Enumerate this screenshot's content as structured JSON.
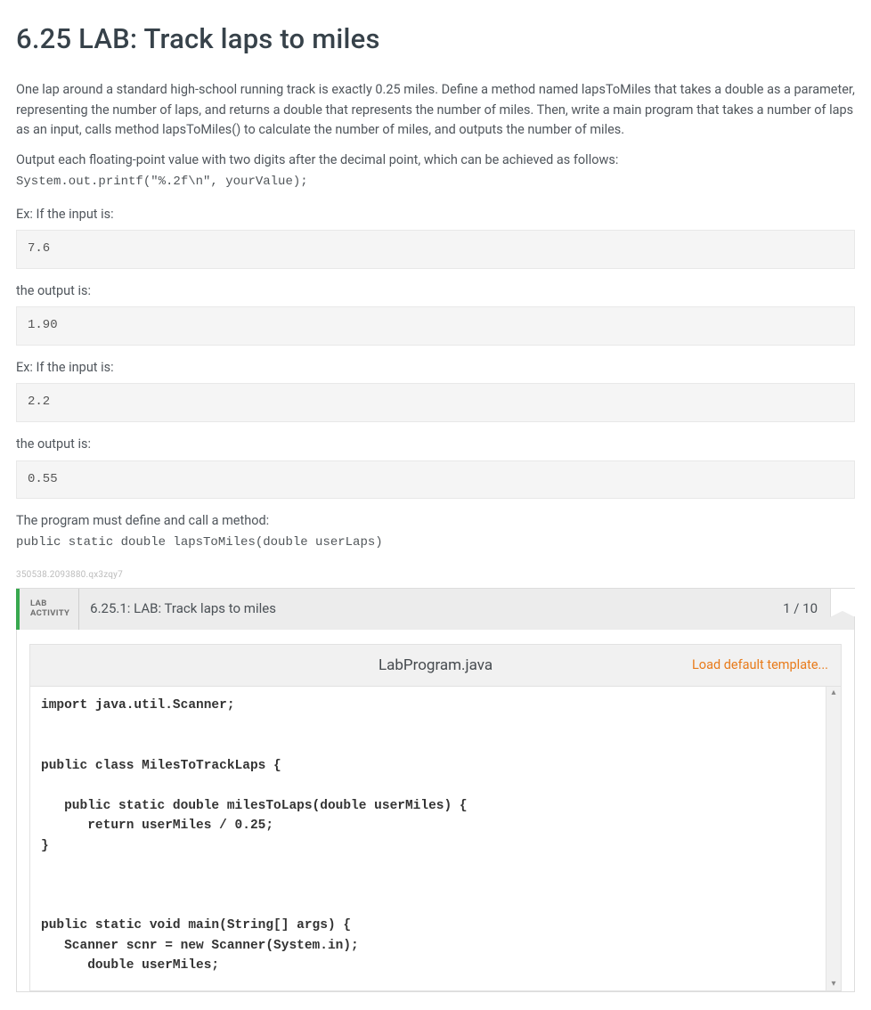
{
  "title": "6.25 LAB: Track laps to miles",
  "description": {
    "p1": "One lap around a standard high-school running track is exactly 0.25 miles. Define a method named lapsToMiles that takes a double as a parameter, representing the number of laps, and returns a double that represents the number of miles. Then, write a main program that takes a number of laps as an input, calls method lapsToMiles() to calculate the number of miles, and outputs the number of miles.",
    "p2": "Output each floating-point value with two digits after the decimal point, which can be achieved as follows:",
    "printf_line": "System.out.printf(\"%.2f\\n\", yourValue);"
  },
  "examples": {
    "ex_if_input": "Ex: If the input is:",
    "the_output_is": "the output is:",
    "ex1_input": "7.6",
    "ex1_output": "1.90",
    "ex2_input": "2.2",
    "ex2_output": "0.55"
  },
  "method_req": {
    "line1": "The program must define and call a method:",
    "signature": "public static double lapsToMiles(double userLaps)"
  },
  "assignment_id": "350538.2093880.qx3zqy7",
  "lab": {
    "badge_line1": "LAB",
    "badge_line2": "ACTIVITY",
    "title": "6.25.1: LAB: Track laps to miles",
    "score": "1 / 10",
    "filename": "LabProgram.java",
    "load_template_label": "Load default template...",
    "code": "import java.util.Scanner;\n\n\npublic class MilesToTrackLaps {\n\n   public static double milesToLaps(double userMiles) {\n      return userMiles / 0.25;\n}\n\n\n\npublic static void main(String[] args) {\n   Scanner scnr = new Scanner(System.in);\n      double userMiles;"
  }
}
